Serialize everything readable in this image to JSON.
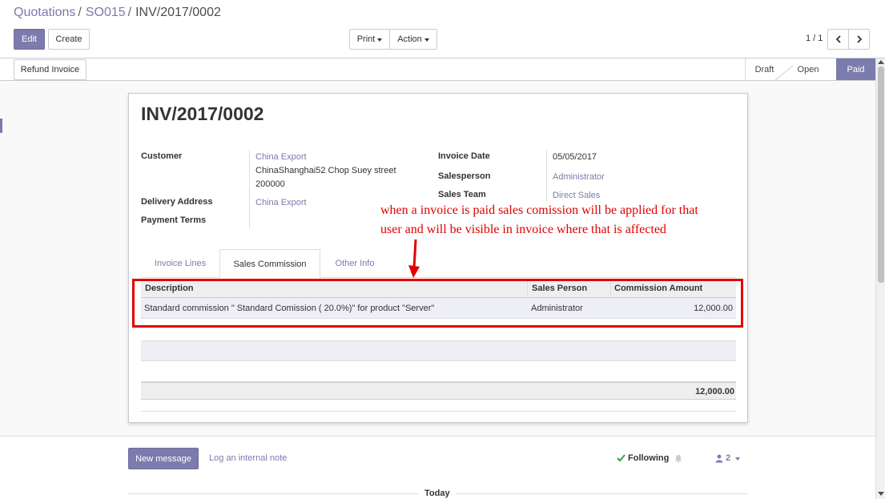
{
  "breadcrumb": {
    "item1": "Quotations",
    "item2": "SO015",
    "current": "INV/2017/0002",
    "sep": "/"
  },
  "toolbar": {
    "edit": "Edit",
    "create": "Create",
    "print": "Print",
    "action": "Action"
  },
  "pager": {
    "value": "1 / 1"
  },
  "statusbar": {
    "refund": "Refund Invoice",
    "stages": [
      "Draft",
      "Open",
      "Paid"
    ],
    "active_stage": "Paid"
  },
  "invoice": {
    "title": "INV/2017/0002",
    "customer_label": "Customer",
    "customer_name": "China Export",
    "customer_address1": "ChinaShanghai52 Chop Suey street",
    "customer_address2": "200000",
    "delivery_label": "Delivery Address",
    "delivery_value": "China Export",
    "payment_terms_label": "Payment Terms",
    "invoice_date_label": "Invoice Date",
    "invoice_date": "05/05/2017",
    "salesperson_label": "Salesperson",
    "salesperson": "Administrator",
    "sales_team_label": "Sales Team",
    "sales_team": "Direct Sales"
  },
  "tabs": [
    "Invoice Lines",
    "Sales Commission",
    "Other Info"
  ],
  "commission_table": {
    "headers": [
      "Description",
      "Sales Person",
      "Commission Amount"
    ],
    "rows": [
      {
        "description": "Standard commission \" Standard Comission ( 20.0%)\" for product \"Server\"",
        "sales_person": "Administrator",
        "amount": "12,000.00"
      }
    ]
  },
  "total": "12,000.00",
  "annotation": {
    "line1": "when a invoice is paid sales comission will be applied for that",
    "line2": "user and  will be visible in invoice  where that is affected"
  },
  "chatter": {
    "new_message": "New message",
    "log_note": "Log an internal note",
    "following": "Following",
    "followers": "2",
    "today": "Today"
  },
  "colors": {
    "accent": "#7c7bad",
    "annotation": "#e00000"
  }
}
